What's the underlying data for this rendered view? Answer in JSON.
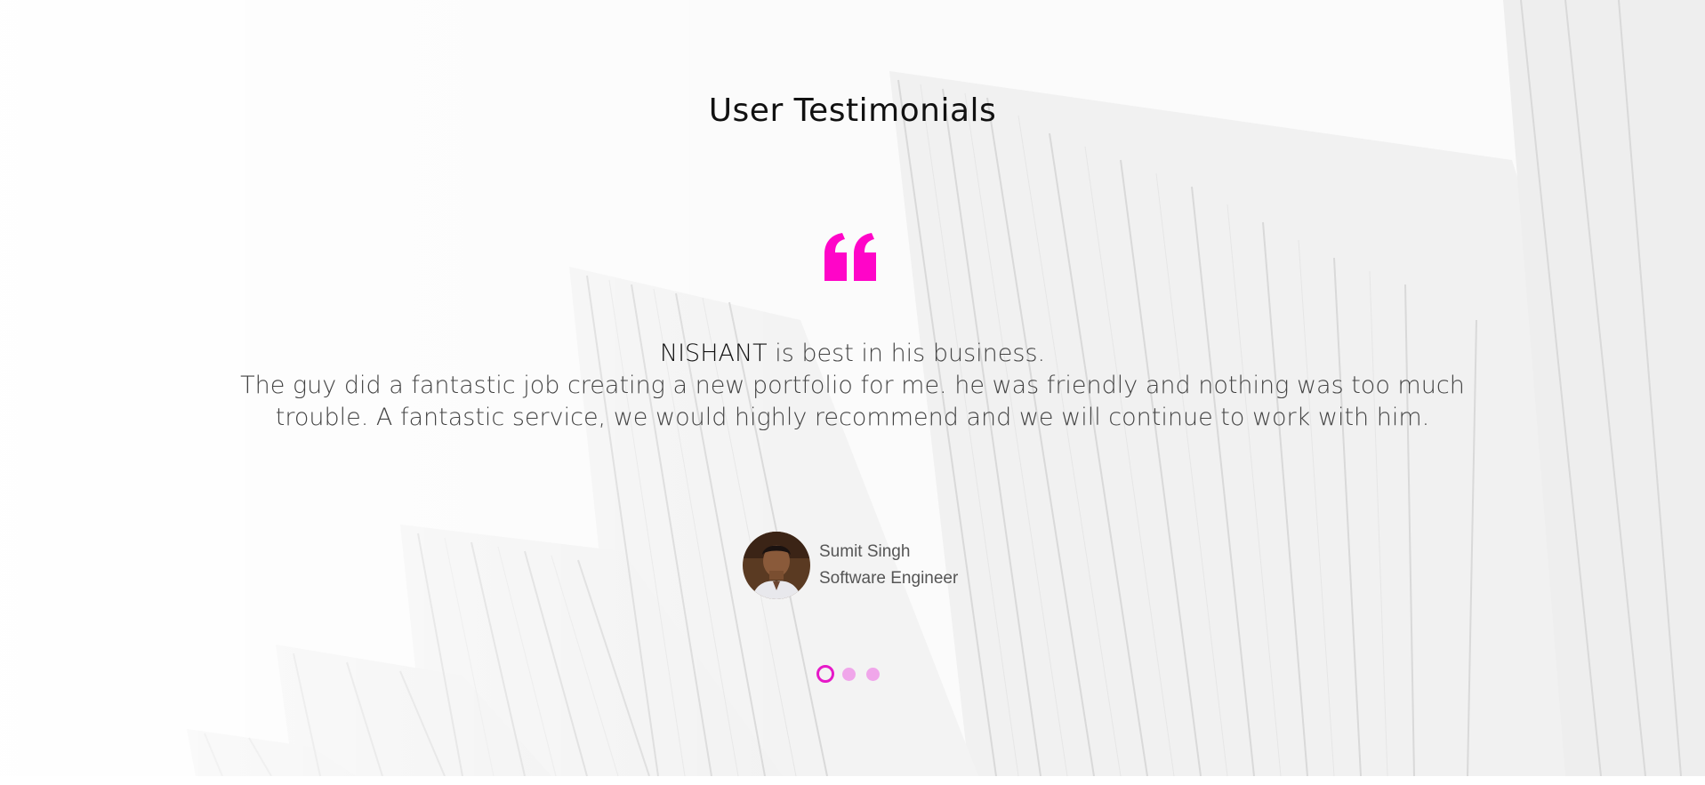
{
  "section": {
    "title": "User Testimonials"
  },
  "quote_icon": {
    "name": "quote-icon",
    "color": "#ff05c8"
  },
  "testimonial": {
    "highlight_name": "NISHANT",
    "headline_rest": " is best in his business.",
    "body": "The guy did a fantastic job creating a new portfolio for me. he was friendly and nothing was too much trouble. A fantastic service, we would highly recommend and we will continue to work with him."
  },
  "author": {
    "name": "Sumit Singh",
    "role": "Software Engineer"
  },
  "carousel": {
    "slide_count": 3,
    "active_index": 0,
    "active_color": "#e619c8",
    "inactive_color": "#f0a6ea"
  }
}
